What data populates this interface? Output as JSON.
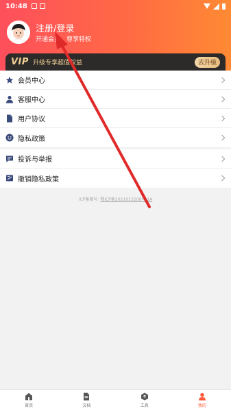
{
  "status_bar": {
    "time": "10:48"
  },
  "profile": {
    "title": "注册/登录",
    "subtitle": "开通会员，尊享特权"
  },
  "vip_banner": {
    "tag": "VIP",
    "text": "升级专享超值权益",
    "button": "去升级"
  },
  "menu_group_1": [
    {
      "label": "会员中心",
      "icon": "star-icon"
    },
    {
      "label": "客服中心",
      "icon": "person-icon"
    },
    {
      "label": "用户协议",
      "icon": "document-icon"
    },
    {
      "label": "隐私政策",
      "icon": "smile-icon"
    }
  ],
  "menu_group_2": [
    {
      "label": "投诉与举报",
      "icon": "chat-icon"
    },
    {
      "label": "撤销隐私政策",
      "icon": "revoke-icon"
    }
  ],
  "icp": {
    "prefix": "ICP备案号:",
    "number": "鄂ICP备2021013208号-2A"
  },
  "tabbar": [
    {
      "label": "首页",
      "icon": "home-icon",
      "active": false
    },
    {
      "label": "文档",
      "icon": "doc-icon",
      "active": false
    },
    {
      "label": "工具",
      "icon": "tool-icon",
      "active": false
    },
    {
      "label": "我的",
      "icon": "user-icon",
      "active": true
    }
  ],
  "colors": {
    "header_start": "#fe4f5c",
    "header_end": "#ff8a33",
    "vip_gold": "#f0cf93",
    "active_tab": "#ff5a3c",
    "annotation_arrow": "#e02a2a"
  }
}
